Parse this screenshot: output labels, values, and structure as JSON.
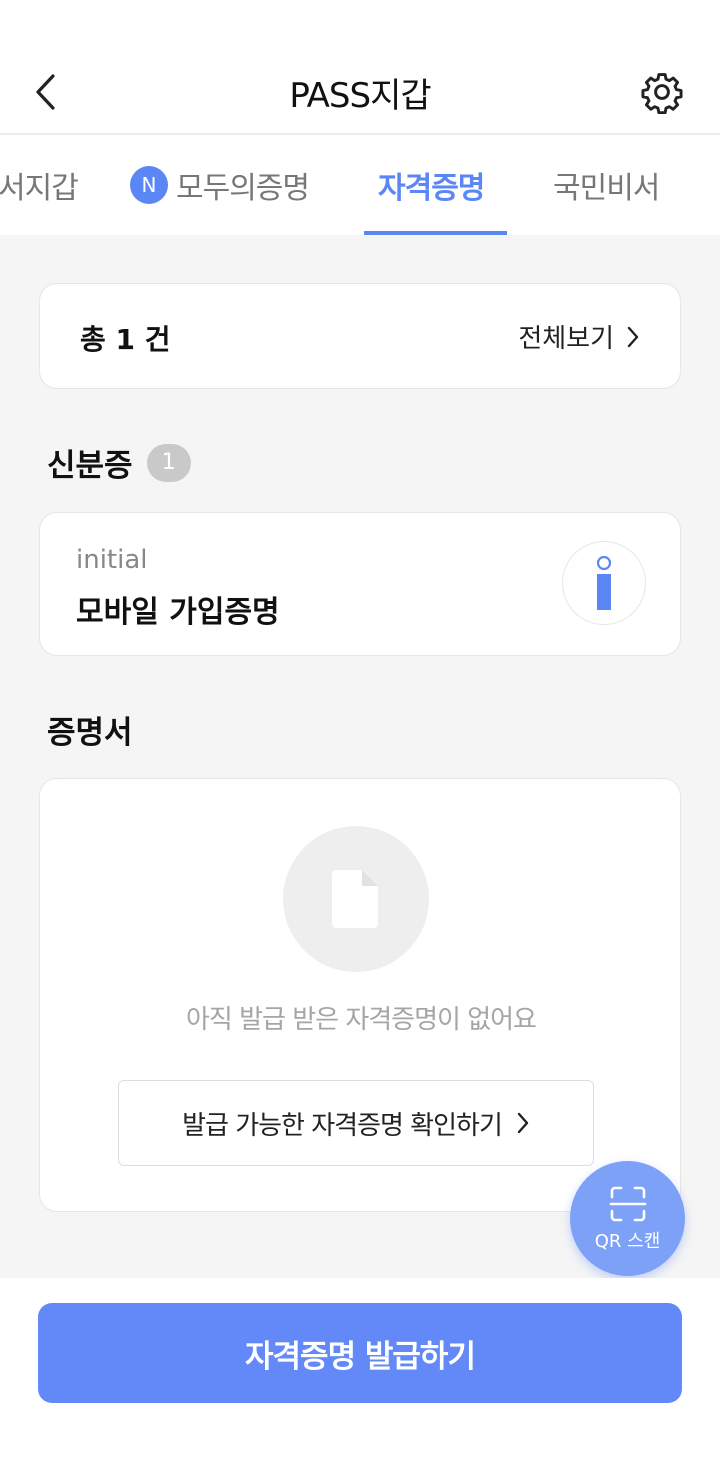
{
  "header": {
    "title": "PASS지갑",
    "back_icon": "chevron-left-icon",
    "settings_icon": "gear-icon"
  },
  "tabs": [
    {
      "label": "서지갑",
      "active": false
    },
    {
      "label": "모두의증명",
      "badge": "N",
      "active": false
    },
    {
      "label": "자격증명",
      "active": true
    },
    {
      "label": "국민비서",
      "active": false
    }
  ],
  "summary": {
    "count_label": "총 1 건",
    "view_all_label": "전체보기"
  },
  "id_section": {
    "title": "신분증",
    "count": "1",
    "card": {
      "subtitle": "initial",
      "title": "모바일 가입증명",
      "icon": "info-icon"
    }
  },
  "cert_section": {
    "title": "증명서",
    "empty_icon": "document-icon",
    "empty_text": "아직 발급 받은 자격증명이 없어요",
    "check_button_label": "발급 가능한 자격증명 확인하기"
  },
  "qr_button": {
    "label": "QR 스캔",
    "icon": "qr-scan-icon"
  },
  "issue_button": {
    "label": "자격증명 발급하기"
  },
  "colors": {
    "accent": "#5b86f5",
    "primary_button": "#6389f8",
    "background": "#f5f5f5"
  }
}
